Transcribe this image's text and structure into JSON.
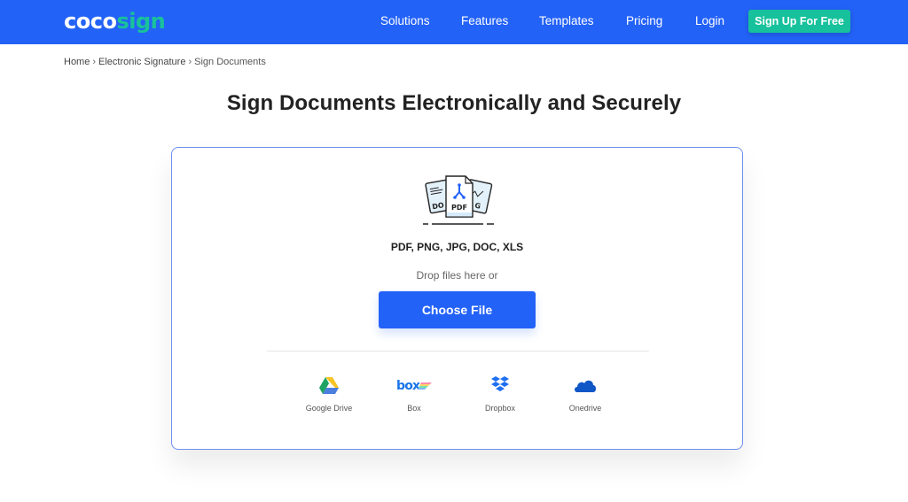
{
  "nav": {
    "logo_part1": "coco",
    "logo_part2": "sign",
    "links": [
      "Solutions",
      "Features",
      "Templates",
      "Pricing",
      "Login"
    ],
    "signup_label": "Sign Up For Free"
  },
  "breadcrumb": {
    "items": [
      "Home",
      "Electronic Signature"
    ],
    "separator": "›",
    "current": "Sign Documents"
  },
  "page_title": "Sign Documents Electronically and Securely",
  "upload": {
    "icon_label": "PDF",
    "formats": "PDF, PNG, JPG, DOC, XLS",
    "drop_text": "Drop files here or",
    "choose_label": "Choose File"
  },
  "services": [
    {
      "name": "Google Drive",
      "icon": "google-drive-icon"
    },
    {
      "name": "Box",
      "icon": "box-icon"
    },
    {
      "name": "Dropbox",
      "icon": "dropbox-icon"
    },
    {
      "name": "Onedrive",
      "icon": "onedrive-icon"
    }
  ],
  "colors": {
    "brand_blue": "#2362f7",
    "brand_green": "#17c19c",
    "card_border": "#6f8ff0"
  }
}
